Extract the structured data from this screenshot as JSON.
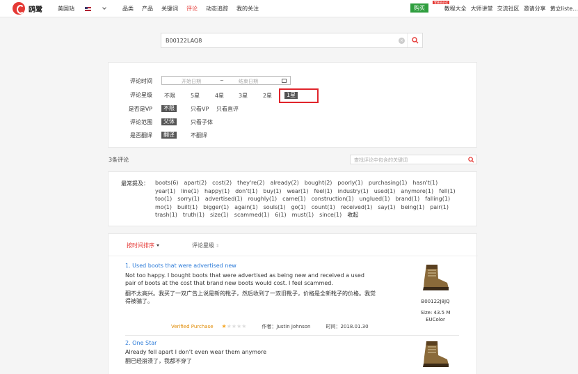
{
  "brand": {
    "name": "鸥鹭"
  },
  "nav": {
    "site": "美国站",
    "items": [
      "品类",
      "产品",
      "关键词",
      "评论",
      "动态追踪",
      "我的关注"
    ],
    "active_index": 3
  },
  "right_nav": {
    "buy": "购买",
    "badge": "零基础必读",
    "items": [
      "教程大全",
      "大师讲堂",
      "交流社区",
      "邀请分享",
      "黄立liste..."
    ]
  },
  "search": {
    "value": "B00122LAQ8"
  },
  "filters": {
    "time_label": "评论时间",
    "start_placeholder": "开始日期",
    "sep": "~",
    "end_placeholder": "结束日期",
    "rating_label": "评论星级",
    "rating_options": [
      "不限",
      "5星",
      "4星",
      "3星",
      "2星",
      "1星"
    ],
    "rating_selected": "1星",
    "vp_label": "是否是VP",
    "vp_options": [
      "不限",
      "只看VP",
      "只看直评"
    ],
    "scope_label": "评论范围",
    "scope_options": [
      "父体",
      "只看子体"
    ],
    "translate_label": "是否翻译",
    "translate_options": [
      "翻译",
      "不翻译"
    ]
  },
  "count_text": "3条评论",
  "keyword_search_placeholder": "查找评论中包含的关键词",
  "keywords": {
    "label": "最常提及：",
    "items": [
      "boots(6)",
      "apart(2)",
      "cost(2)",
      "they're(2)",
      "already(2)",
      "bought(2)",
      "poorly(1)",
      "purchasing(1)",
      "hasn't(1)",
      "year(1)",
      "line(1)",
      "happy(1)",
      "don’t(1)",
      "buy(1)",
      "wear(1)",
      "feel(1)",
      "industry(1)",
      "used(1)",
      "anymore(1)",
      "fell(1)",
      "too(1)",
      "sorry(1)",
      "advertised(1)",
      "roughly(1)",
      "came(1)",
      "construction(1)",
      "unglued(1)",
      "brand(1)",
      "falling(1)",
      "mo(1)",
      "built(1)",
      "bigger(1)",
      "again(1)",
      "souls(1)",
      "go(1)",
      "count(1)",
      "received(1)",
      "say(1)",
      "being(1)",
      "pair(1)",
      "trash(1)",
      "truth(1)",
      "size(1)",
      "scammed(1)",
      "6(1)",
      "must(1)",
      "since(1)"
    ],
    "collapse": "收起"
  },
  "sort": {
    "by_time": "按时间排序",
    "by_rating": "评论星级"
  },
  "reviews": [
    {
      "title": "1. Used boots that were advertised new",
      "text_en": "Not too happy. I bought boots that were advertised as being new and received a used pair of boots at the cost that brand new boots would cost. I feel scammed.",
      "text_zh": "翻不太高兴。我买了一双广告上说是新的靴子，然后收到了一双旧靴子，价格是全新靴子的价格。我觉得被骗了。",
      "verified": "Verified Purchase",
      "rating": 1,
      "author": "作者：Justin Johnson",
      "time": "时间：2018.01.30",
      "asin": "B00122J8JQ",
      "size": "Size:  43.5 M",
      "color": "EUColor"
    },
    {
      "title": "2. One Star",
      "text_en": "Already fell apart I don’t even wear them anymore",
      "text_zh": "翻已经崩溃了，我都不穿了"
    }
  ],
  "colors": {
    "accent": "#e53935",
    "link": "#2a7ad8",
    "buy": "#2e9e3e",
    "highlight": "#e0242b"
  }
}
